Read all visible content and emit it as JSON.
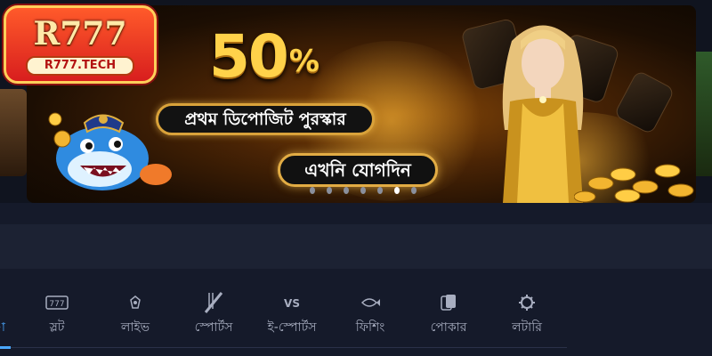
{
  "logo": {
    "name": "R777",
    "domain": "R777.TECH"
  },
  "banner": {
    "percent": "50",
    "percent_sign": "%",
    "subtitle": "প্রথম ডিপোজিট পুরস্কার",
    "cta": "এখনি যোগদিন",
    "slide_count": 7,
    "active_slide": 6
  },
  "nav": {
    "active_label": "া",
    "items": [
      {
        "label": "স্লট",
        "icon": "slot-machine-icon"
      },
      {
        "label": "লাইভ",
        "icon": "live-casino-icon"
      },
      {
        "label": "স্পোর্টস",
        "icon": "sports-bat-icon"
      },
      {
        "label": "ই-স্পোর্টস",
        "icon": "versus-icon"
      },
      {
        "label": "ফিশিং",
        "icon": "fishing-icon"
      },
      {
        "label": "পোকার",
        "icon": "poker-cards-icon"
      },
      {
        "label": "লটারি",
        "icon": "lottery-icon"
      }
    ]
  },
  "colors": {
    "background": "#151a2a",
    "accent": "#4aa8ff",
    "gold": "#ffd24a",
    "logo_red": "#d81e1e"
  }
}
